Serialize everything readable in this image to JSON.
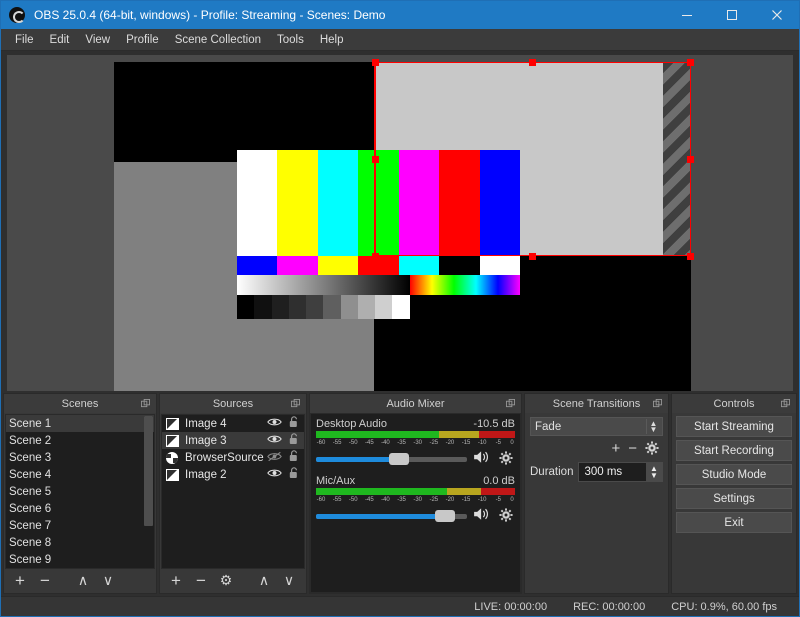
{
  "window": {
    "title": "OBS 25.0.4 (64-bit, windows) - Profile: Streaming - Scenes: Demo",
    "app_icon": "obs-logo-icon",
    "minimize": "minimize-icon",
    "maximize": "maximize-icon",
    "close": "close-icon",
    "accent_color": "#1f7ac4"
  },
  "menubar": {
    "items": [
      "File",
      "Edit",
      "View",
      "Profile",
      "Scene Collection",
      "Tools",
      "Help"
    ]
  },
  "preview": {
    "selection_color": "#ff0000",
    "background_color": "#4a4a4a"
  },
  "docks": {
    "scenes": {
      "title": "Scenes",
      "float_icon": "undock-icon",
      "items": [
        "Scene 1",
        "Scene 2",
        "Scene 3",
        "Scene 4",
        "Scene 5",
        "Scene 6",
        "Scene 7",
        "Scene 8",
        "Scene 9"
      ],
      "selected_index": 0,
      "toolbar": [
        {
          "name": "add-scene-button",
          "glyph": "+"
        },
        {
          "name": "remove-scene-button",
          "glyph": "−"
        },
        {
          "name": "move-scene-up-button",
          "glyph": "∧"
        },
        {
          "name": "move-scene-down-button",
          "glyph": "∨"
        }
      ]
    },
    "sources": {
      "title": "Sources",
      "float_icon": "undock-icon",
      "items": [
        {
          "name": "Image 4",
          "icon": "image-icon",
          "visible": true,
          "locked": false
        },
        {
          "name": "Image 3",
          "icon": "image-icon",
          "visible": true,
          "locked": false
        },
        {
          "name": "BrowserSource",
          "icon": "globe-icon",
          "visible": false,
          "locked": false
        },
        {
          "name": "Image 2",
          "icon": "image-icon",
          "visible": true,
          "locked": false
        }
      ],
      "selected_index": 1,
      "toolbar": [
        {
          "name": "add-source-button",
          "glyph": "+"
        },
        {
          "name": "remove-source-button",
          "glyph": "−"
        },
        {
          "name": "source-properties-button",
          "glyph": "⚙"
        },
        {
          "name": "move-source-up-button",
          "glyph": "∧"
        },
        {
          "name": "move-source-down-button",
          "glyph": "∨"
        }
      ]
    },
    "audio_mixer": {
      "title": "Audio Mixer",
      "float_icon": "undock-icon",
      "tick_labels": [
        "-60",
        "-55",
        "-50",
        "-45",
        "-40",
        "-35",
        "-30",
        "-25",
        "-20",
        "-15",
        "-10",
        "-5",
        "0"
      ],
      "channels": [
        {
          "name": "Desktop Audio",
          "level": "-10.5 dB",
          "meter_green_pct": 62,
          "meter_yellow_pct": 20,
          "meter_red_pct": 18,
          "volume_pct": 55,
          "mute_icon": "speaker-icon",
          "settings_icon": "gear-icon"
        },
        {
          "name": "Mic/Aux",
          "level": "0.0 dB",
          "meter_green_pct": 66,
          "meter_yellow_pct": 17,
          "meter_red_pct": 17,
          "volume_pct": 87,
          "mute_icon": "speaker-icon",
          "settings_icon": "gear-icon"
        }
      ]
    },
    "scene_transitions": {
      "title": "Scene Transitions",
      "float_icon": "undock-icon",
      "transition": "Fade",
      "buttons": [
        {
          "name": "add-transition-button",
          "glyph": "+"
        },
        {
          "name": "remove-transition-button",
          "glyph": "−"
        },
        {
          "name": "transition-properties-button",
          "glyph": "⚙"
        }
      ],
      "duration_label": "Duration",
      "duration_value": "300 ms"
    },
    "controls": {
      "title": "Controls",
      "float_icon": "undock-icon",
      "buttons": [
        {
          "name": "start-streaming-button",
          "label": "Start Streaming"
        },
        {
          "name": "start-recording-button",
          "label": "Start Recording"
        },
        {
          "name": "studio-mode-button",
          "label": "Studio Mode"
        },
        {
          "name": "settings-button",
          "label": "Settings"
        },
        {
          "name": "exit-button",
          "label": "Exit"
        }
      ]
    }
  },
  "statusbar": {
    "live": "LIVE: 00:00:00",
    "rec": "REC: 00:00:00",
    "cpu": "CPU: 0.9%, 60.00 fps"
  },
  "chart_data": {
    "type": "table",
    "title": "OBS test pattern color bars",
    "bars_top": [
      "#ffffff",
      "#ffff00",
      "#00ffff",
      "#00ff00",
      "#ff00ff",
      "#ff0000",
      "#0000ff"
    ],
    "bars_bottom": [
      "#0000ff",
      "#ff00ff",
      "#ffff00",
      "#ff0000",
      "#00ffff",
      "#000000",
      "#ffffff"
    ],
    "grayscale_steps": [
      "#000000",
      "#101010",
      "#1f1f1f",
      "#2f2f2f",
      "#3f3f3f",
      "#5f5f5f",
      "#8f8f8f",
      "#afafaf",
      "#cfcfcf",
      "#ffffff"
    ]
  }
}
